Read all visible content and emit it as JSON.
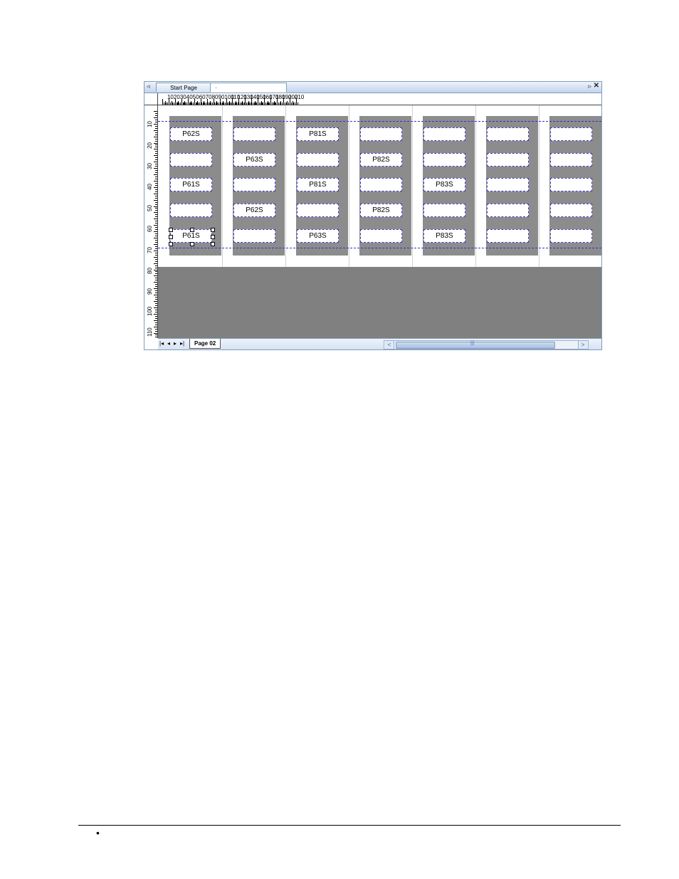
{
  "window": {
    "tabs": [
      {
        "label": "Start Page"
      },
      {
        "label": "·"
      }
    ],
    "left_arrow": "◃",
    "right_arrow": "▹",
    "close": "✕"
  },
  "ruler": {
    "horizontal_labels": [
      "10",
      "20",
      "30",
      "40",
      "50",
      "60",
      "70",
      "80",
      "90",
      "100",
      "110",
      "120",
      "130",
      "140",
      "150",
      "160",
      "170",
      "180",
      "190",
      "200",
      "210"
    ],
    "vertical_labels": [
      "10",
      "20",
      "30",
      "40",
      "50",
      "60",
      "70",
      "80",
      "90",
      "100",
      "110"
    ]
  },
  "slots": [
    {
      "label": "P62S"
    },
    {
      "label": ""
    },
    {
      "label": "P81S"
    },
    {
      "label": ""
    },
    {
      "label": ""
    },
    {
      "label": ""
    },
    {
      "label": ""
    },
    {
      "label": ""
    },
    {
      "label": "P63S"
    },
    {
      "label": ""
    },
    {
      "label": "P82S"
    },
    {
      "label": ""
    },
    {
      "label": ""
    },
    {
      "label": ""
    },
    {
      "label": "P61S"
    },
    {
      "label": ""
    },
    {
      "label": "P81S"
    },
    {
      "label": ""
    },
    {
      "label": "P83S"
    },
    {
      "label": ""
    },
    {
      "label": ""
    },
    {
      "label": ""
    },
    {
      "label": "P62S"
    },
    {
      "label": ""
    },
    {
      "label": "P82S"
    },
    {
      "label": ""
    },
    {
      "label": ""
    },
    {
      "label": ""
    },
    {
      "label": "P61S"
    },
    {
      "label": ""
    },
    {
      "label": "P63S"
    },
    {
      "label": ""
    },
    {
      "label": "P83S"
    },
    {
      "label": ""
    },
    {
      "label": ""
    }
  ],
  "bottom_bar": {
    "nav_first": "|◂",
    "nav_prev": "◂",
    "nav_next": "▸",
    "nav_last": "▸|",
    "page_tab": "Page 02",
    "scroll_left": "<",
    "scroll_right": ">",
    "scroll_grip": "|||"
  },
  "footer": {
    "bullet": "•"
  },
  "colors": {
    "page": "#ffffff",
    "column": "#8c8c8c",
    "workspace": "#808080",
    "guide": "#3333cc"
  }
}
